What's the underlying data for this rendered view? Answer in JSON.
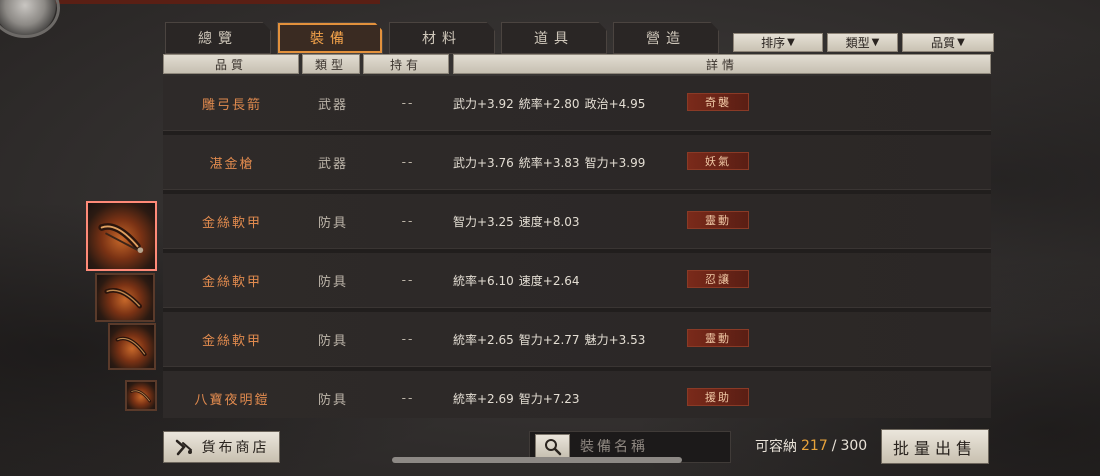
{
  "tabs": [
    {
      "label": "總覽",
      "active": false
    },
    {
      "label": "裝備",
      "active": true
    },
    {
      "label": "材料",
      "active": false
    },
    {
      "label": "道具",
      "active": false
    },
    {
      "label": "營造",
      "active": false
    }
  ],
  "filters": {
    "sort_label": "排序",
    "type_label": "類型",
    "quality_label": "品質"
  },
  "columns": {
    "quality": "品質",
    "type": "類型",
    "owned": "持有",
    "details": "詳情"
  },
  "rows": [
    {
      "name": "雕弓長箭",
      "type": "武器",
      "owned": "--",
      "stats": [
        "武力+3.92",
        "統率+2.80",
        "政治+4.95"
      ],
      "tag": "奇襲"
    },
    {
      "name": "湛金槍",
      "type": "武器",
      "owned": "--",
      "stats": [
        "武力+3.76",
        "統率+3.83",
        "智力+3.99"
      ],
      "tag": "妖氣"
    },
    {
      "name": "金絲軟甲",
      "type": "防具",
      "owned": "--",
      "stats": [
        "智力+3.25",
        "速度+8.03"
      ],
      "tag": "靈動"
    },
    {
      "name": "金絲軟甲",
      "type": "防具",
      "owned": "--",
      "stats": [
        "統率+6.10",
        "速度+2.64"
      ],
      "tag": "忍讓"
    },
    {
      "name": "金絲軟甲",
      "type": "防具",
      "owned": "--",
      "stats": [
        "統率+2.65",
        "智力+2.77",
        "魅力+3.53"
      ],
      "tag": "靈動"
    },
    {
      "name": "八寶夜明鎧",
      "type": "防具",
      "owned": "--",
      "stats": [
        "統率+2.69",
        "智力+7.23"
      ],
      "tag": "援助"
    }
  ],
  "bottom": {
    "shop_label": "貨布商店",
    "search_placeholder": "裝備名稱",
    "capacity_label": "可容納",
    "capacity_current": "217",
    "capacity_sep": "/",
    "capacity_max": "300",
    "sell_label": "批量出售"
  },
  "colors": {
    "accent": "#e2913c",
    "item_name": "#e08a4e",
    "tag_bg": "#7a2a1a"
  }
}
